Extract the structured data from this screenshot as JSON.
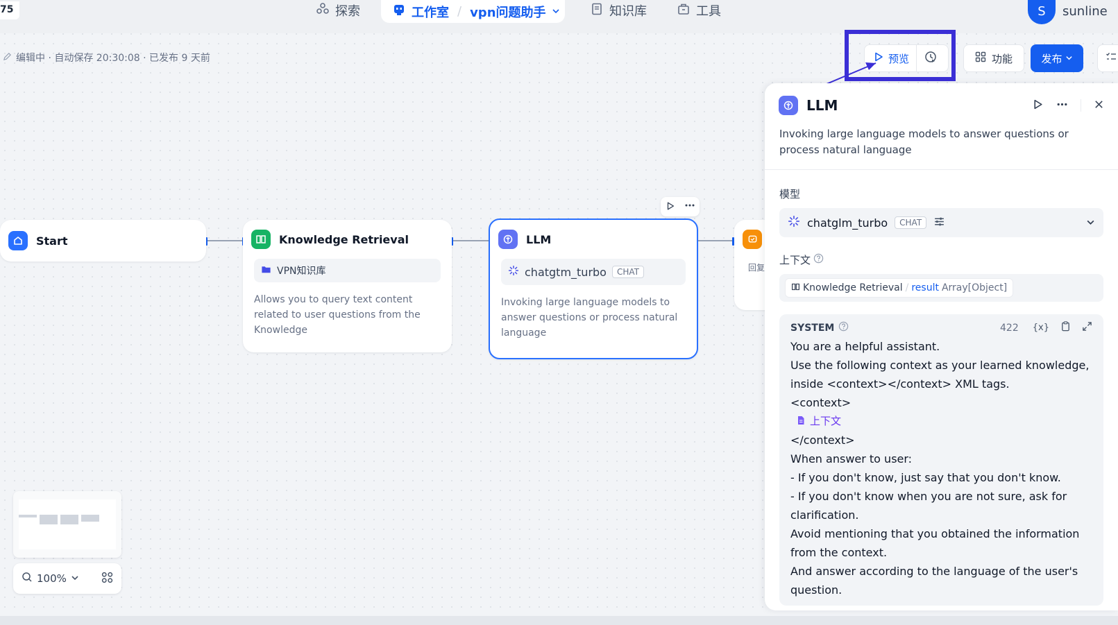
{
  "topbar": {
    "corner_number": "75",
    "nav_explore": "探索",
    "nav_studio": "工作室",
    "app_name": "vpn问题助手",
    "nav_knowledge": "知识库",
    "nav_tools": "工具",
    "user_initial": "S",
    "user_name": "sunline"
  },
  "status": {
    "text": "编辑中 · 自动保存 20:30:08 · 已发布 9 天前"
  },
  "toolbar": {
    "preview_label": "预览",
    "features_label": "功能",
    "publish_label": "发布"
  },
  "nodes": {
    "start": {
      "title": "Start"
    },
    "knowledge": {
      "title": "Knowledge Retrieval",
      "dataset": "VPN知识库",
      "desc": "Allows you to query text content related to user questions from the Knowledge"
    },
    "llm": {
      "title": "LLM",
      "model": "chatgtm_turbo",
      "tag": "CHAT",
      "desc": "Invoking large language models to answer questions or process natural language"
    },
    "answer": {
      "partial_label": "回复"
    }
  },
  "panel": {
    "title": "LLM",
    "desc": "Invoking large language models to answer questions or process natural language",
    "model_label": "模型",
    "model_name": "chatglm_turbo",
    "model_tag": "CHAT",
    "context_label": "上下文",
    "context_node": "Knowledge Retrieval",
    "context_sep": "/",
    "context_var": "result",
    "context_type": "Array[Object]",
    "system_label": "SYSTEM",
    "token_count": "422",
    "prompt_lines": [
      "You are a helpful assistant.",
      "Use the following context as your learned knowledge, inside <context></context> XML tags.",
      "<context>",
      "</context>",
      "When answer to user:",
      "- If you don't know, just say that you don't know.",
      "- If you don't know when you are not sure, ask for clarification.",
      "Avoid mentioning that you obtained the information from the context.",
      "And answer according to the language of the user's question."
    ],
    "context_variable_label": "上下文"
  },
  "zoom": {
    "level": "100%"
  },
  "colors": {
    "accent": "#155eef",
    "highlight": "#3b2fd6",
    "start_icon": "#2970ff",
    "knowledge_icon": "#16b364",
    "llm_icon": "#6172f3",
    "answer_icon": "#f79009"
  }
}
